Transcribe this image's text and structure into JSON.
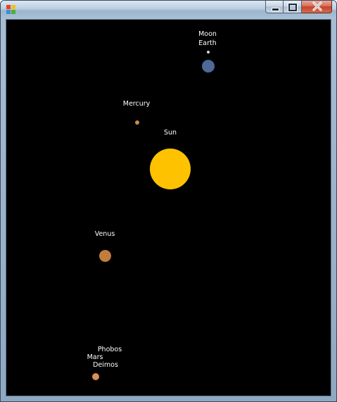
{
  "window": {
    "title": "",
    "icon": "application-icon",
    "buttons": [
      "minimize-icon",
      "maximize-icon",
      "close-icon"
    ]
  },
  "colors": {
    "background": "#000000",
    "sun": "#FFC200",
    "earth": "#4E6899",
    "moon": "#D8D8D8",
    "mercury": "#C88A55",
    "venus": "#C07E3C",
    "mars": "#D98E55",
    "label": "#FFFFFF"
  },
  "bodies": {
    "sun": "Sun",
    "mercury": "Mercury",
    "venus": "Venus",
    "earth": "Earth",
    "moon": "Moon",
    "mars": "Mars",
    "phobos": "Phobos",
    "deimos": "Deimos"
  }
}
